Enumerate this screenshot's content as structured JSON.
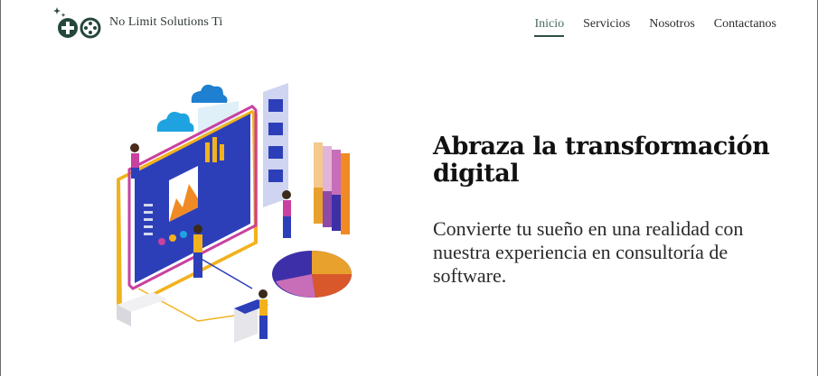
{
  "brand": {
    "name": "No Limit Solutions Ti",
    "logo_icon": "gamepad-icon",
    "color": "#24473a"
  },
  "nav": [
    {
      "label": "Inicio",
      "active": true
    },
    {
      "label": "Servicios",
      "active": false
    },
    {
      "label": "Nosotros",
      "active": false
    },
    {
      "label": "Contactanos",
      "active": false
    }
  ],
  "hero": {
    "title": "Abraza la transformación digital",
    "subtitle": "Convierte tu sueño en una realidad con nuestra experiencia en consultoría de software."
  },
  "colors": {
    "accent": "#486b5c",
    "brand_dark": "#24473a",
    "text": "#111111"
  }
}
